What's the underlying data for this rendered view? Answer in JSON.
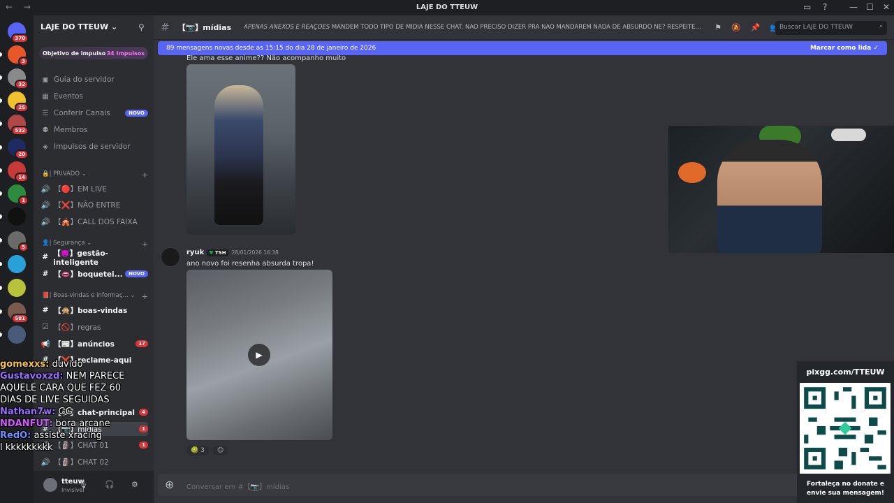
{
  "window": {
    "title": "LAJE DO TTEUW",
    "nav_glyphs": "← →",
    "controls": {
      "minimize": "—",
      "maximize": "☐",
      "close": "✕"
    }
  },
  "server": {
    "name": "LAJE DO TTEUW",
    "boost_label": "Objetivo de impulso",
    "boost_count": "34 Impulsos"
  },
  "rail": {
    "home_badge": "370",
    "servers": [
      {
        "badge": "3",
        "color": "#e8572a"
      },
      {
        "badge": "32",
        "color": "#8a8a8a"
      },
      {
        "badge": "25",
        "color": "#f2c12e"
      },
      {
        "badge": "532",
        "color": "#b04848"
      },
      {
        "badge": "20",
        "color": "#1f2a60"
      },
      {
        "badge": "14",
        "color": "#c83a3a"
      },
      {
        "badge": "1",
        "color": "#2e8a3e"
      },
      {
        "badge": "",
        "color": "#111111"
      },
      {
        "badge": "5",
        "color": "#6a6a6a"
      },
      {
        "badge": "",
        "color": "#2aa0d8"
      },
      {
        "badge": "",
        "color": "#b8c23a"
      },
      {
        "badge": "581",
        "color": "#7a5a4a"
      },
      {
        "badge": "",
        "color": "#4a5a7a"
      }
    ]
  },
  "nav": [
    {
      "label": "Guia do servidor",
      "icon": "▣"
    },
    {
      "label": "Eventos",
      "icon": "▦"
    },
    {
      "label": "Conferir Canais",
      "icon": "☰",
      "badge": "NOVO"
    },
    {
      "label": "Membros",
      "icon": "⚉"
    },
    {
      "label": "Impulsos de servidor",
      "icon": "◈"
    }
  ],
  "categories": {
    "privado": "🔒| PRIVADO ⌄",
    "seguranca": "👤| Segurança ⌄",
    "boas_vindas": "📕| Boas-vindas e informaç... ⌄"
  },
  "channels": {
    "privado": [
      {
        "label": "【🔴】EM LIVE",
        "icon": "🔊"
      },
      {
        "label": "【❌】NÃO ENTRE",
        "icon": "🔊"
      },
      {
        "label": "【🎪】CALL DOS FAIXA",
        "icon": "🔊"
      }
    ],
    "seguranca": [
      {
        "label": "【👿】gestão-inteligente",
        "icon": "#"
      },
      {
        "label": "【👄】boquetei...",
        "icon": "#",
        "badge": "NOVO"
      }
    ],
    "boas_vindas": [
      {
        "label": "【🙊】boas-vindas",
        "icon": "#"
      },
      {
        "label": "【🚫】regras",
        "icon": "☑"
      },
      {
        "label": "【📰】anúncios",
        "icon": "📢",
        "count": "17"
      },
      {
        "label": "【❌】reclame-aqui",
        "icon": "#"
      }
    ],
    "geral": [
      {
        "label": "【💬】chat-principal",
        "icon": "#",
        "count": "4"
      },
      {
        "label": "【📷】mídias",
        "icon": "#",
        "count": "1"
      },
      {
        "label": "【🗿】CHAT 01",
        "icon": "🔊",
        "count": "1"
      },
      {
        "label": "【🗿】CHAT 02",
        "icon": "🔊"
      }
    ]
  },
  "user": {
    "name": "tteuw",
    "status": "Invisível"
  },
  "header": {
    "channel": "【📷】mídias",
    "topic_bold": "APENAS ANEXOS E REAÇÕES",
    "topic": " MANDEM TODO TIPO DE MÍDIA NESSE CHAT. NÃO PRECISO DIZER PRA NAO MANDAREM NADA DE ABSURDO NÉ? RESPEITEM U...",
    "search_placeholder": "Buscar LAJE DO TTEUW"
  },
  "newbar": {
    "text": "89 mensagens novas desde as 15:15 do dia 28 de janeiro de 2026",
    "action": "Marcar como lida"
  },
  "messages": {
    "first_text": "Ele ama esse anime?? Não acompanho muito",
    "second": {
      "author": "ryuk",
      "tag": "TSH",
      "timestamp": "28/01/2026 16:38",
      "text": "ano novo foi resenha absurda tropa!"
    },
    "reactions": [
      {
        "emoji": "🥝",
        "count": "3"
      },
      {
        "emoji": "☺",
        "count": ""
      }
    ]
  },
  "composer": {
    "placeholder": "Conversar em #【📷】mídias"
  },
  "twitch_chat": [
    {
      "user": "gomexxs:",
      "text": " duvido",
      "color": "#f2c14e"
    },
    {
      "user": "Gustavoxzd:",
      "text": " NEM PARECE",
      "color": "#9a6cff"
    },
    {
      "user": "",
      "text": "AQUELE CARA QUE FEZ 60",
      "color": "#ffffff"
    },
    {
      "user": "",
      "text": "DIAS DE LIVE SEGUIDAS",
      "color": "#ffffff"
    },
    {
      "user": "Nathan7w:",
      "text": " GG",
      "color": "#9a6cff"
    },
    {
      "user": "NDANFUT:",
      "text": " bora arcane",
      "color": "#d05cff"
    },
    {
      "user": "RedO:",
      "text": " assiste xracing",
      "color": "#6c8cff"
    },
    {
      "user": "",
      "text": "l kkkkkkkkk",
      "color": "#ffffff"
    }
  ],
  "donate": {
    "url": "pixgg.com/TTEUW",
    "cta": "Fortaleça no donate e envie sua mensagem!"
  }
}
